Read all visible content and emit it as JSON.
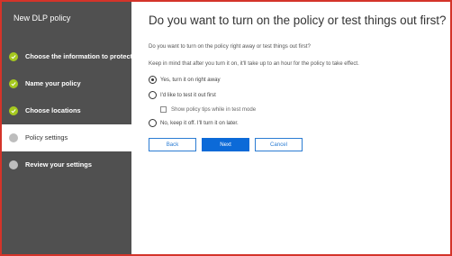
{
  "sidebar": {
    "title": "New DLP policy",
    "steps": [
      {
        "label": "Choose the information to protect",
        "status": "completed"
      },
      {
        "label": "Name your policy",
        "status": "completed"
      },
      {
        "label": "Choose locations",
        "status": "completed"
      },
      {
        "label": "Policy settings",
        "status": "current"
      },
      {
        "label": "Review your settings",
        "status": "upcoming"
      }
    ]
  },
  "main": {
    "heading": "Do you want to turn on the policy or test things out first?",
    "question": "Do you want to turn on the policy right away or test things out first?",
    "note": "Keep in mind that after you turn it on, it'll take up to an hour for the policy to take effect.",
    "options": {
      "turn_on": {
        "label": "Yes, turn it on right away",
        "checked": true
      },
      "test": {
        "label": "I'd like to test it out first",
        "checked": false
      },
      "policy_tips": {
        "label": "Show policy tips while in test mode",
        "checked": false,
        "enabled": false
      },
      "keep_off": {
        "label": "No, keep it off. I'll turn it on later.",
        "checked": false
      }
    },
    "buttons": {
      "back": "Back",
      "next": "Next",
      "cancel": "Cancel"
    }
  },
  "colors": {
    "sidebar_bg": "#505050",
    "completed_dot": "#a6c91f",
    "pending_dot": "#bdbdbd",
    "primary_button": "#0c6ad8",
    "frame_border": "#d4342a"
  }
}
